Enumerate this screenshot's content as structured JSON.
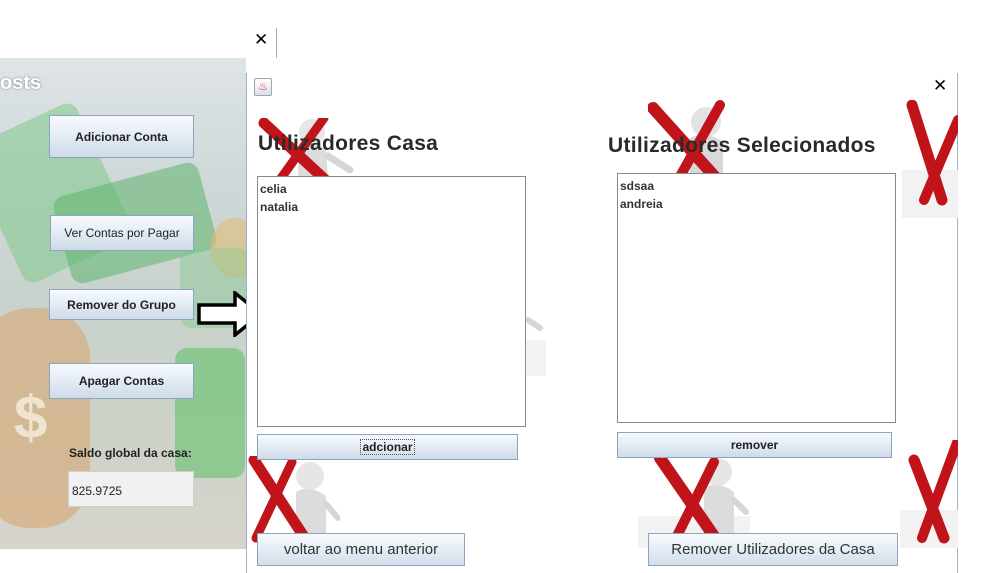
{
  "back_window": {
    "title_fragment": "osts",
    "buttons": [
      {
        "label": "Adicionar Conta"
      },
      {
        "label": "Ver Contas por Pagar"
      },
      {
        "label": "Remover do Grupo"
      },
      {
        "label": "Apagar Contas"
      }
    ],
    "saldo_label": "Saldo global da casa:",
    "saldo_value": "825.9725"
  },
  "front_window": {
    "left_heading": "Utilizadores Casa",
    "right_heading": "Utilizadores Selecionados",
    "left_list": [
      "celia",
      "natalia"
    ],
    "right_list": [
      "sdsaa",
      "andreia"
    ],
    "add_button": "adcionar",
    "remove_button": "remover",
    "back_button": "voltar ao menu anterior",
    "remove_users_button": "Remover Utilizadores da Casa"
  },
  "colors": {
    "accent_x": "#c0141a",
    "button_border": "#8ea4be"
  }
}
